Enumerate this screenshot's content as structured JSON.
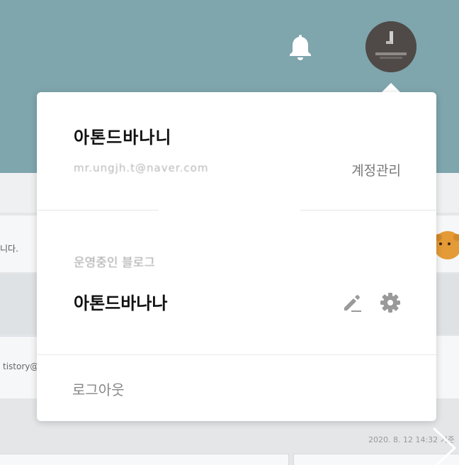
{
  "header": {
    "background_color": "#7fa5ad",
    "notification_icon": "bell-icon",
    "avatar_icon": "user-avatar"
  },
  "background_page": {
    "row_text": "니다.",
    "row2_text": "tistory@",
    "date_text": "2020. 8. 12 14:32 기준"
  },
  "account_menu": {
    "nickname": "아톤드바나니",
    "email": "mr.ungjh.t@naver.com",
    "account_link": "계정관리",
    "section_label": "운영중인 블로그",
    "blog_name": "아톤드바나나",
    "edit_icon": "pencil-icon",
    "settings_icon": "gear-icon",
    "logout": "로그아웃"
  }
}
